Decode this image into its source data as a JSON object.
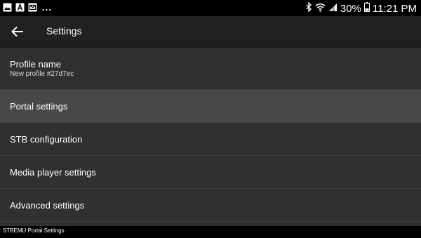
{
  "status_bar": {
    "overflow": "...",
    "battery": "30%",
    "time": "11:21 PM",
    "icons": [
      "gallery-icon",
      "text-a-icon",
      "mail-icon",
      "bluetooth-icon",
      "wifi-icon",
      "signal-icon",
      "battery-icon"
    ]
  },
  "app_bar": {
    "title": "Settings",
    "back_icon": "arrow-back-icon"
  },
  "settings": {
    "profile_name": {
      "title": "Profile name",
      "value": "New profile #27d7ec"
    },
    "portal": {
      "title": "Portal settings"
    },
    "stb": {
      "title": "STB configuration"
    },
    "media_player": {
      "title": "Media player settings"
    },
    "advanced": {
      "title": "Advanced settings"
    }
  },
  "toast": {
    "text": "STBEMU Portal Settings"
  },
  "colors": {
    "background": "#303030",
    "app_bar": "#212121",
    "selected_row": "#484848",
    "status_bar": "#000000"
  }
}
